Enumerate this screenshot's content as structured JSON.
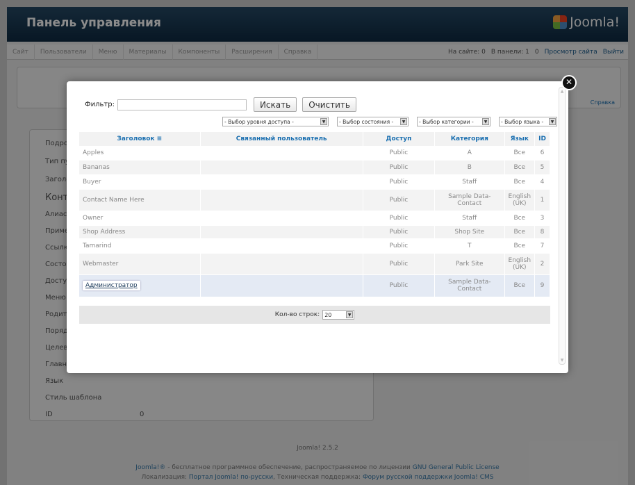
{
  "header": {
    "title": "Панель управления",
    "logo": "Joomla!"
  },
  "menu": {
    "items": [
      "Сайт",
      "Пользователи",
      "Меню",
      "Материалы",
      "Компоненты",
      "Расширения",
      "Справка"
    ],
    "on_site": "На сайте: 0",
    "in_panel": "В панели: 1",
    "messages": "0",
    "view_site": "Просмотр сайта",
    "logout": "Выйти"
  },
  "background": {
    "help": "Справка",
    "labels": [
      "Подро",
      "Тип пун",
      "Заголо",
      "Конта",
      "Алиас",
      "Приме",
      "Ссылка",
      "Состоя",
      "Доступ",
      "Меню",
      "Родите",
      "Порядо",
      "Целево",
      "Главна",
      "Язык",
      "Стиль шаблона",
      "ID"
    ],
    "id_value": "0"
  },
  "modal": {
    "filter_label": "Фильтр:",
    "search_button": "Искать",
    "clear_button": "Очистить",
    "selects": [
      "- Выбор уровня доступа -",
      "- Выбор состояния -",
      "- Выбор категории -",
      "- Выбор языка -"
    ],
    "columns": [
      "Заголовок",
      "Связанный пользователь",
      "Доступ",
      "Категория",
      "Язык",
      "ID"
    ],
    "rows": [
      {
        "title": "Apples",
        "user": "",
        "access": "Public",
        "category": "A",
        "lang": "Все",
        "id": "6"
      },
      {
        "title": "Bananas",
        "user": "",
        "access": "Public",
        "category": "B",
        "lang": "Все",
        "id": "5"
      },
      {
        "title": "Buyer",
        "user": "",
        "access": "Public",
        "category": "Staff",
        "lang": "Все",
        "id": "4"
      },
      {
        "title": "Contact Name Here",
        "user": "",
        "access": "Public",
        "category": "Sample Data-Contact",
        "lang": "English (UK)",
        "id": "1"
      },
      {
        "title": "Owner",
        "user": "",
        "access": "Public",
        "category": "Staff",
        "lang": "Все",
        "id": "3"
      },
      {
        "title": "Shop Address",
        "user": "",
        "access": "Public",
        "category": "Shop Site",
        "lang": "Все",
        "id": "8"
      },
      {
        "title": "Tamarind",
        "user": "",
        "access": "Public",
        "category": "T",
        "lang": "Все",
        "id": "7"
      },
      {
        "title": "Webmaster",
        "user": "",
        "access": "Public",
        "category": "Park Site",
        "lang": "English (UK)",
        "id": "2"
      },
      {
        "title": "Администратор",
        "user": "",
        "access": "Public",
        "category": "Sample Data-Contact",
        "lang": "Все",
        "id": "9"
      }
    ],
    "rows_label": "Кол-во строк:",
    "rows_value": "20"
  },
  "footer": {
    "version": "Joomla! 2.5.2",
    "line1_a": "Joomla!®",
    "line1_b": " - бесплатное программное обеспечение, распространяемое по лицензии ",
    "line1_c": "GNU General Public License",
    "line2_a": "Локализация: ",
    "line2_b": "Портал Joomla! по-русски",
    "line2_c": ", Техническая поддержка: ",
    "line2_d": "Форум русской поддержки Joomla! CMS"
  }
}
